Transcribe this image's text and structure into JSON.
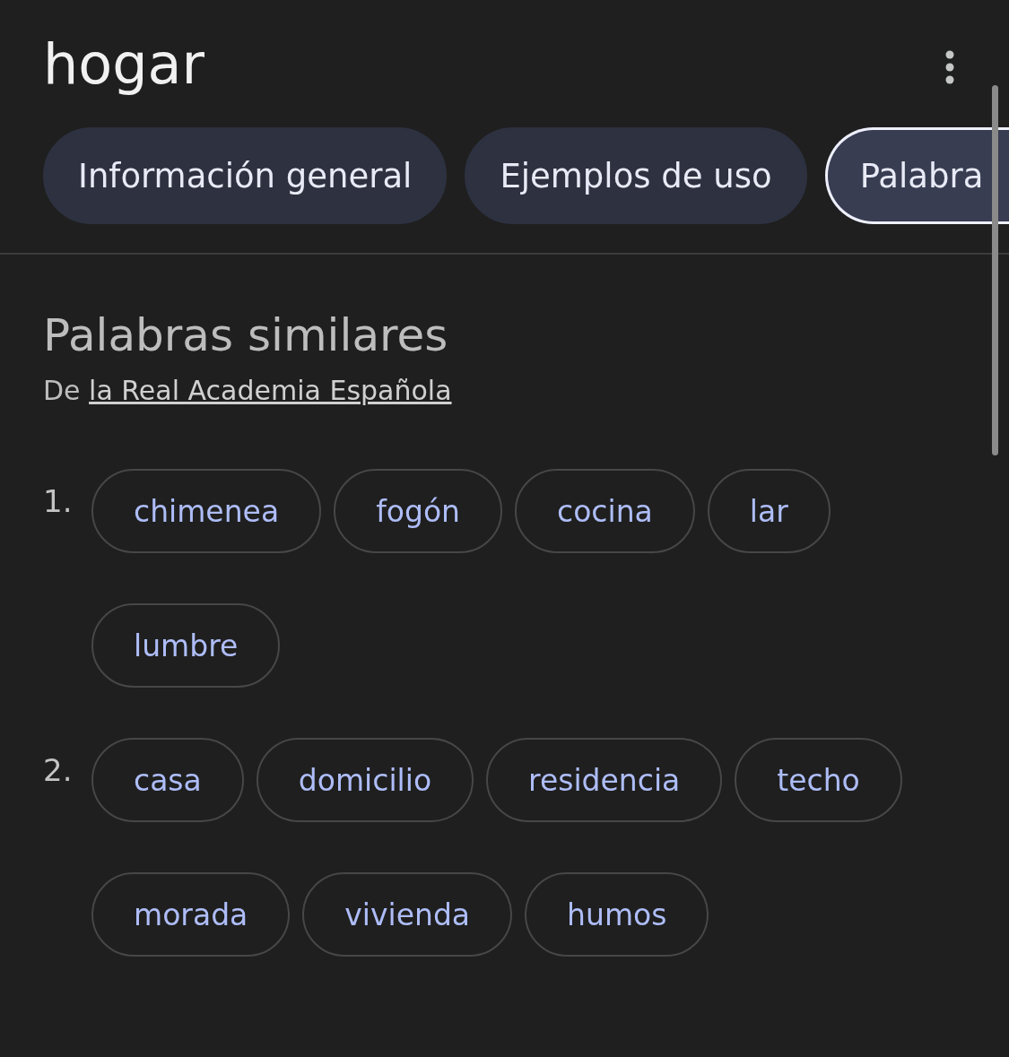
{
  "title": "hogar",
  "tabs": [
    {
      "label": "Información general",
      "selected": false
    },
    {
      "label": "Ejemplos de uso",
      "selected": false
    },
    {
      "label": "Palabra",
      "selected": true
    }
  ],
  "section": {
    "heading": "Palabras similares",
    "source_prefix": "De",
    "source_link": "la Real Academia Española",
    "groups": [
      {
        "number": "1.",
        "words": [
          "chimenea",
          "fogón",
          "cocina",
          "lar",
          "lumbre"
        ]
      },
      {
        "number": "2.",
        "words": [
          "casa",
          "domicilio",
          "residencia",
          "techo",
          "morada",
          "vivienda",
          "humos"
        ]
      }
    ]
  }
}
